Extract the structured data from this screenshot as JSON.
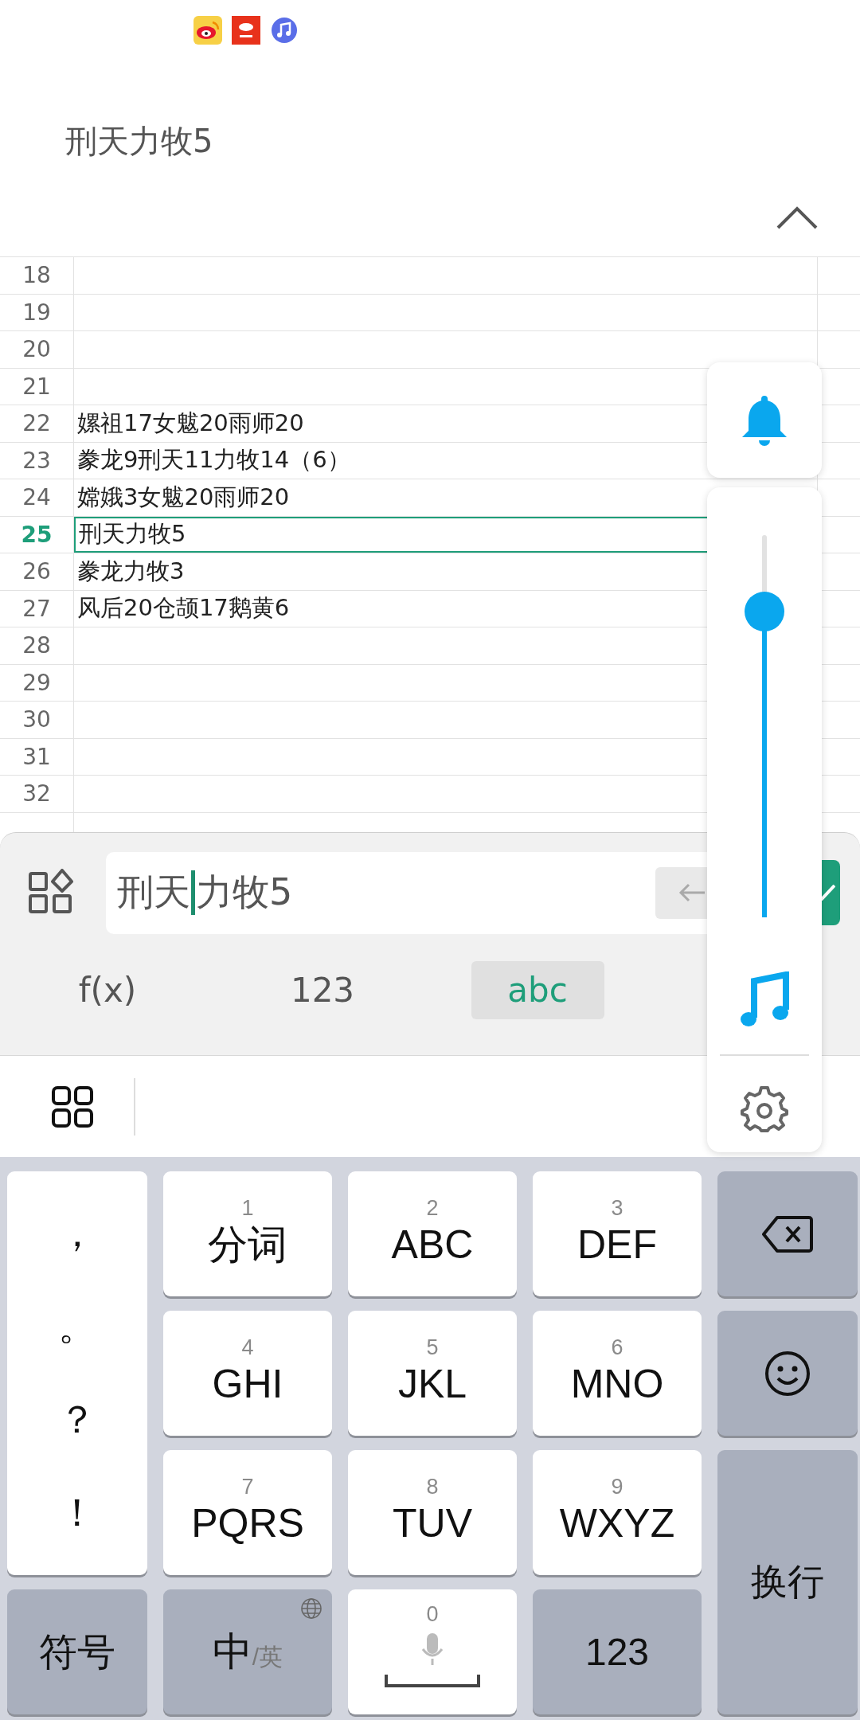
{
  "title": "刑天力牧5",
  "sheet": {
    "rows": [
      {
        "number": "18",
        "selected": false
      },
      {
        "number": "19",
        "selected": false
      },
      {
        "number": "20",
        "selected": false
      },
      {
        "number": "21",
        "selected": false
      },
      {
        "number": "22",
        "cell": "嫘祖17女魃20雨师20",
        "selected": false
      },
      {
        "number": "23",
        "cell": "豢龙9刑天11力牧14（6）",
        "selected": false
      },
      {
        "number": "24",
        "cell": "嫦娥3女魃20雨师20",
        "selected": false
      },
      {
        "number": "25",
        "cell": "刑天力牧5",
        "selected": true
      },
      {
        "number": "26",
        "cell": "豢龙力牧3",
        "selected": false
      },
      {
        "number": "27",
        "cell": "风后20仓颉17鹅黄6",
        "selected": false
      },
      {
        "number": "28",
        "selected": false
      },
      {
        "number": "29",
        "selected": false
      },
      {
        "number": "30",
        "selected": false
      },
      {
        "number": "31",
        "selected": false
      },
      {
        "number": "32",
        "selected": false
      }
    ]
  },
  "formula_bar": {
    "value_before_caret": "刑天",
    "value_after_caret": "力牧5"
  },
  "input_modes": [
    {
      "label": "f(x)",
      "selected": false
    },
    {
      "label": "123",
      "selected": false
    },
    {
      "label": "abc",
      "selected": true
    }
  ],
  "keyboard": {
    "keys": [
      {
        "kind": "punct",
        "chars": [
          "，",
          "。",
          "？",
          "！"
        ]
      },
      {
        "kind": "letter",
        "digit": "1",
        "label": "分词"
      },
      {
        "kind": "letter",
        "digit": "2",
        "label": "ABC"
      },
      {
        "kind": "letter",
        "digit": "3",
        "label": "DEF"
      },
      {
        "kind": "backspace"
      },
      {
        "kind": "letter",
        "digit": "4",
        "label": "GHI"
      },
      {
        "kind": "letter",
        "digit": "5",
        "label": "JKL"
      },
      {
        "kind": "letter",
        "digit": "6",
        "label": "MNO"
      },
      {
        "kind": "emoji"
      },
      {
        "kind": "letter",
        "digit": "7",
        "label": "PQRS"
      },
      {
        "kind": "letter",
        "digit": "8",
        "label": "TUV"
      },
      {
        "kind": "letter",
        "digit": "9",
        "label": "WXYZ"
      },
      {
        "kind": "enter",
        "label": "换行"
      },
      {
        "kind": "mod",
        "label": "符号"
      },
      {
        "kind": "lang",
        "label": "中",
        "sub": "/英"
      },
      {
        "kind": "space",
        "digit": "0"
      },
      {
        "kind": "mod",
        "label": "123"
      }
    ]
  },
  "volume_panel": {
    "level": 0.8
  }
}
